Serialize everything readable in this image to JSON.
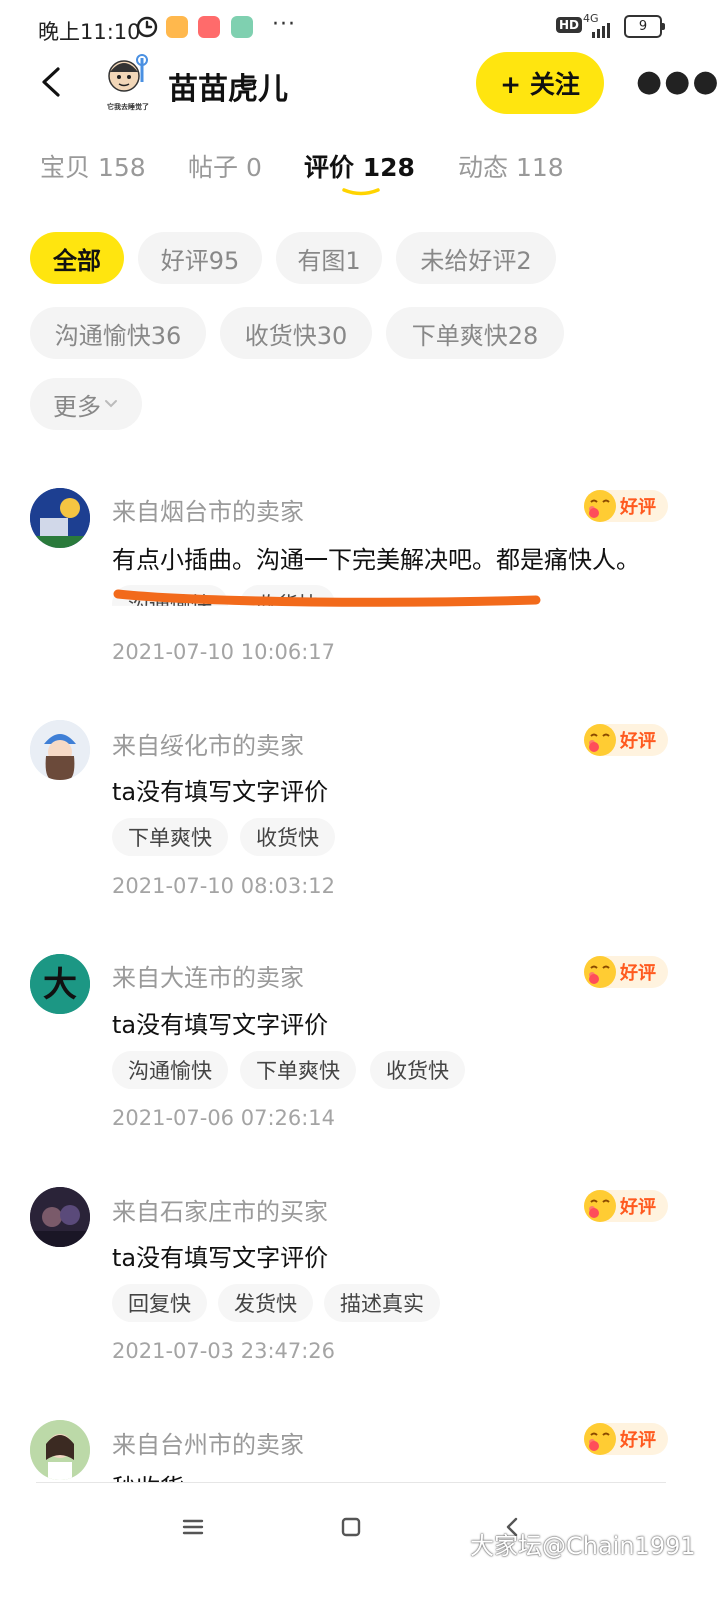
{
  "status_bar": {
    "time": "晚上11:10",
    "dots": "···",
    "hd": "HD",
    "network": "4G",
    "battery": "9",
    "app_icon_colors": [
      "#ffb84d",
      "#ff6b6b",
      "#7fd0b0"
    ]
  },
  "header": {
    "back_icon": "back-arrow-icon",
    "shop_name": "苗苗虎儿",
    "avatar_caption": "它我去睡觉了",
    "follow_label": "+ 关注",
    "more_icon": "more-icon"
  },
  "tabs": [
    {
      "label": "宝贝 158",
      "active": false
    },
    {
      "label": "帖子 0",
      "active": false
    },
    {
      "label": "评价 128",
      "active": true
    },
    {
      "label": "动态 118",
      "active": false
    }
  ],
  "filters": [
    {
      "label": "全部",
      "active": true
    },
    {
      "label": "好评95",
      "active": false
    },
    {
      "label": "有图1",
      "active": false
    },
    {
      "label": "未给好评2",
      "active": false
    },
    {
      "label": "沟通愉快36",
      "active": false
    },
    {
      "label": "收货快30",
      "active": false
    },
    {
      "label": "下单爽快28",
      "active": false
    },
    {
      "label": "更多",
      "active": false
    }
  ],
  "reviews": [
    {
      "from": "来自烟台市的卖家",
      "badge": "好评",
      "comment": "有点小插曲。沟通一下完美解决吧。都是痛快人。",
      "tags": [
        "沟通愉快",
        "收货快"
      ],
      "date": "2021-07-10 10:06:17"
    },
    {
      "from": "来自绥化市的卖家",
      "badge": "好评",
      "comment": "ta没有填写文字评价",
      "tags": [
        "下单爽快",
        "收货快"
      ],
      "date": "2021-07-10 08:03:12"
    },
    {
      "from": "来自大连市的卖家",
      "badge": "好评",
      "comment": "ta没有填写文字评价",
      "tags": [
        "沟通愉快",
        "下单爽快",
        "收货快"
      ],
      "date": "2021-07-06 07:26:14"
    },
    {
      "from": "来自石家庄市的买家",
      "badge": "好评",
      "comment": "ta没有填写文字评价",
      "tags": [
        "回复快",
        "发货快",
        "描述真实"
      ],
      "date": "2021-07-03 23:47:26"
    },
    {
      "from": "来自台州市的卖家",
      "badge": "好评",
      "comment": "秒收货"
    }
  ],
  "watermark": "大家坛@Chain1991",
  "colors": {
    "accent": "#ffe50f",
    "highlight_stroke": "#f26a1b",
    "badge_text": "#ff5a1f"
  }
}
